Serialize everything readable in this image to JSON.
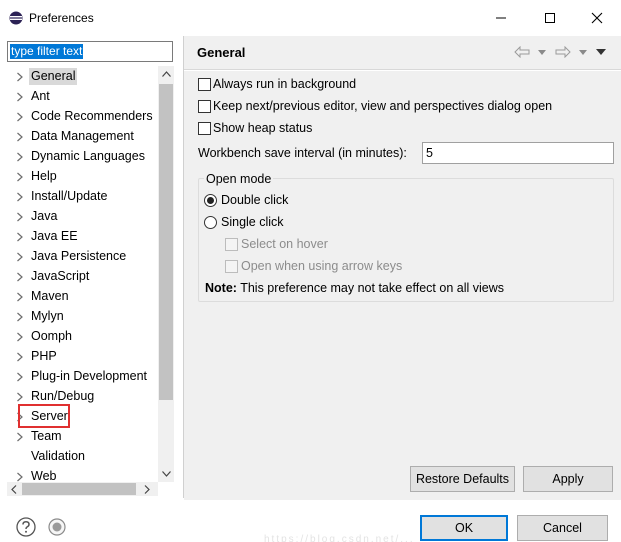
{
  "window": {
    "title": "Preferences",
    "app_icon": "eclipse-icon",
    "controls": [
      "minimize-icon",
      "maximize-icon",
      "close-icon"
    ]
  },
  "filter": {
    "value": "type filter text"
  },
  "tree": {
    "items": [
      {
        "label": "General",
        "expandable": true,
        "selected": true
      },
      {
        "label": "Ant",
        "expandable": true
      },
      {
        "label": "Code Recommenders",
        "expandable": true
      },
      {
        "label": "Data Management",
        "expandable": true
      },
      {
        "label": "Dynamic Languages",
        "expandable": true
      },
      {
        "label": "Help",
        "expandable": true
      },
      {
        "label": "Install/Update",
        "expandable": true
      },
      {
        "label": "Java",
        "expandable": true
      },
      {
        "label": "Java EE",
        "expandable": true
      },
      {
        "label": "Java Persistence",
        "expandable": true
      },
      {
        "label": "JavaScript",
        "expandable": true
      },
      {
        "label": "Maven",
        "expandable": true
      },
      {
        "label": "Mylyn",
        "expandable": true
      },
      {
        "label": "Oomph",
        "expandable": true
      },
      {
        "label": "PHP",
        "expandable": true
      },
      {
        "label": "Plug-in Development",
        "expandable": true
      },
      {
        "label": "Run/Debug",
        "expandable": true
      },
      {
        "label": "Server",
        "expandable": true,
        "highlighted": true
      },
      {
        "label": "Team",
        "expandable": true
      },
      {
        "label": "Validation",
        "expandable": false
      },
      {
        "label": "Web",
        "expandable": true
      }
    ],
    "highlight_color": "#e03030"
  },
  "page": {
    "title": "General",
    "options": {
      "always_run_background": {
        "label": "Always run in background",
        "checked": false
      },
      "keep_next_previous": {
        "label": "Keep next/previous editor, view and perspectives dialog open",
        "checked": false
      },
      "show_heap_status": {
        "label": "Show heap status",
        "checked": false
      }
    },
    "workbench_interval": {
      "label": "Workbench save interval (in minutes):",
      "value": "5"
    },
    "open_mode": {
      "legend": "Open mode",
      "double_click": {
        "label": "Double click",
        "selected": true
      },
      "single_click": {
        "label": "Single click",
        "selected": false
      },
      "select_on_hover": {
        "label": "Select on hover",
        "enabled": false
      },
      "open_arrow_keys": {
        "label": "Open when using arrow keys",
        "enabled": false
      }
    },
    "note": {
      "bold": "Note:",
      "text": " This preference may not take effect on all views"
    },
    "restore_defaults": "Restore Defaults",
    "apply": "Apply"
  },
  "footer": {
    "ok": "OK",
    "cancel": "Cancel",
    "watermark": "https://blog.csdn.net/..."
  },
  "colors": {
    "selection_blue": "#0078d7",
    "panel_bg": "#f0f0f0",
    "disabled_text": "#8c8c8c"
  }
}
